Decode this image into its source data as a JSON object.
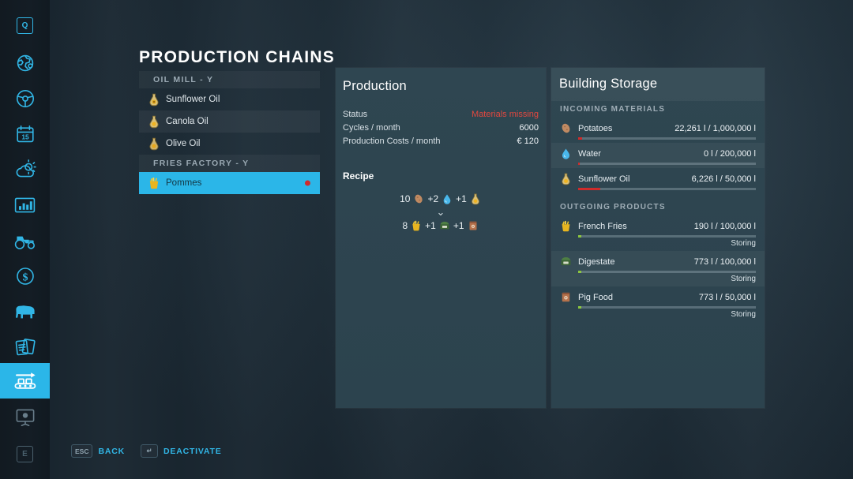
{
  "page": {
    "title": "PRODUCTION CHAINS"
  },
  "sidebar": {
    "items": [
      {
        "name": "key-q",
        "icon": "key-q-icon",
        "active": false,
        "key": "Q"
      },
      {
        "name": "map-globe",
        "icon": "globe-icon",
        "active": false
      },
      {
        "name": "vehicles",
        "icon": "steering-wheel-icon",
        "active": false
      },
      {
        "name": "calendar",
        "icon": "calendar-icon",
        "active": false,
        "day": "15"
      },
      {
        "name": "weather",
        "icon": "weather-icon",
        "active": false
      },
      {
        "name": "statistics",
        "icon": "chart-icon",
        "active": false
      },
      {
        "name": "machines",
        "icon": "tractor-icon",
        "active": false
      },
      {
        "name": "finances",
        "icon": "dollar-icon",
        "active": false
      },
      {
        "name": "animals",
        "icon": "cow-icon",
        "active": false
      },
      {
        "name": "contracts",
        "icon": "documents-icon",
        "active": false
      },
      {
        "name": "production",
        "icon": "conveyor-icon",
        "active": true
      },
      {
        "name": "presentation",
        "icon": "presentation-icon",
        "active": false
      },
      {
        "name": "key-e",
        "icon": "key-e-icon",
        "active": false,
        "key": "E"
      }
    ]
  },
  "chain_list": {
    "groups": [
      {
        "header": "OIL MILL   -  Y",
        "rows": [
          {
            "label": "Sunflower Oil",
            "icon": "oil-bottle-icon",
            "selected": false,
            "alert": false
          },
          {
            "label": "Canola Oil",
            "icon": "oil-bottle-icon",
            "selected": false,
            "alert": false
          },
          {
            "label": "Olive Oil",
            "icon": "oil-bottle-icon",
            "selected": false,
            "alert": false
          }
        ]
      },
      {
        "header": "FRIES FACTORY   -  Y",
        "rows": [
          {
            "label": "Pommes",
            "icon": "fries-icon",
            "selected": true,
            "alert": true
          }
        ]
      }
    ]
  },
  "production": {
    "title": "Production",
    "stats": [
      {
        "label": "Status",
        "value": "Materials missing",
        "alert": true
      },
      {
        "label": "Cycles / month",
        "value": "6000",
        "alert": false
      },
      {
        "label": "Production Costs / month",
        "value": "€ 120",
        "alert": false
      }
    ],
    "recipe_title": "Recipe",
    "recipe": {
      "inputs": [
        {
          "amount": "10",
          "icon": "potato-icon"
        },
        {
          "amount": "+2",
          "icon": "water-icon"
        },
        {
          "amount": "+1",
          "icon": "oil-bottle-icon"
        }
      ],
      "arrow": "⌄",
      "outputs": [
        {
          "amount": "8",
          "icon": "fries-icon"
        },
        {
          "amount": "+1",
          "icon": "digestate-icon"
        },
        {
          "amount": "+1",
          "icon": "pigfood-icon"
        }
      ]
    }
  },
  "storage": {
    "title": "Building Storage",
    "sections": [
      {
        "header": "INCOMING MATERIALS",
        "rows": [
          {
            "name": "Potatoes",
            "icon": "potato-icon",
            "amount": "22,261 l / 1,000,000 l",
            "fill": 2.2,
            "color": "red",
            "status": ""
          },
          {
            "name": "Water",
            "icon": "water-icon",
            "amount": "0 l / 200,000 l",
            "fill": 1.0,
            "color": "red",
            "status": ""
          },
          {
            "name": "Sunflower Oil",
            "icon": "oil-bottle-icon",
            "amount": "6,226 l / 50,000 l",
            "fill": 12.5,
            "color": "red",
            "status": ""
          }
        ]
      },
      {
        "header": "OUTGOING PRODUCTS",
        "rows": [
          {
            "name": "French Fries",
            "icon": "fries-icon",
            "amount": "190 l / 100,000 l",
            "fill": 1.2,
            "color": "green",
            "status": "Storing"
          },
          {
            "name": "Digestate",
            "icon": "digestate-icon",
            "amount": "773 l / 100,000 l",
            "fill": 1.2,
            "color": "green",
            "status": "Storing"
          },
          {
            "name": "Pig Food",
            "icon": "pigfood-icon",
            "amount": "773 l / 50,000 l",
            "fill": 1.6,
            "color": "green",
            "status": "Storing"
          }
        ]
      }
    ]
  },
  "hints": [
    {
      "key": "ESC",
      "label": "BACK"
    },
    {
      "key": "↵",
      "label": "DEACTIVATE"
    }
  ],
  "colors": {
    "accent": "#2bb6e8",
    "alert": "#e2483f",
    "ok": "#8cc63f",
    "panel": "#2f4651"
  }
}
